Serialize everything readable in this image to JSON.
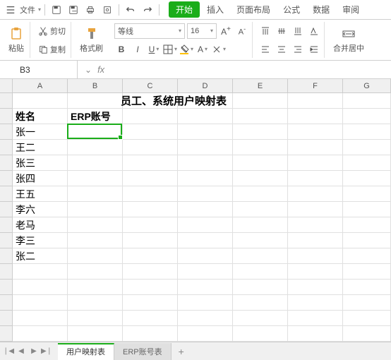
{
  "menubar": {
    "file_label": "文件",
    "start_label": "开始",
    "insert_label": "插入",
    "layout_label": "页面布局",
    "formula_label": "公式",
    "data_label": "数据",
    "review_label": "审阅"
  },
  "ribbon": {
    "cut_label": "剪切",
    "copy_label": "复制",
    "paste_label": "粘贴",
    "format_painter_label": "格式刷",
    "font_name": "等线",
    "font_size": "16",
    "merge_label": "合并居中"
  },
  "namebox": {
    "ref": "B3"
  },
  "columns": [
    "A",
    "B",
    "C",
    "D",
    "E",
    "F",
    "G"
  ],
  "rows_visible": 16,
  "active_cell": {
    "col": "B",
    "row": 3
  },
  "sheet_data": {
    "title": "员工、系统用户映射表",
    "headers": {
      "A2": "姓名",
      "B2": "ERP账号"
    },
    "names": [
      "张一",
      "王二",
      "张三",
      "张四",
      "王五",
      "李六",
      "老马",
      "李三",
      "张二"
    ]
  },
  "sheets": {
    "tabs": [
      "用户映射表",
      "ERP账号表"
    ],
    "active": 0,
    "add_label": "+"
  }
}
